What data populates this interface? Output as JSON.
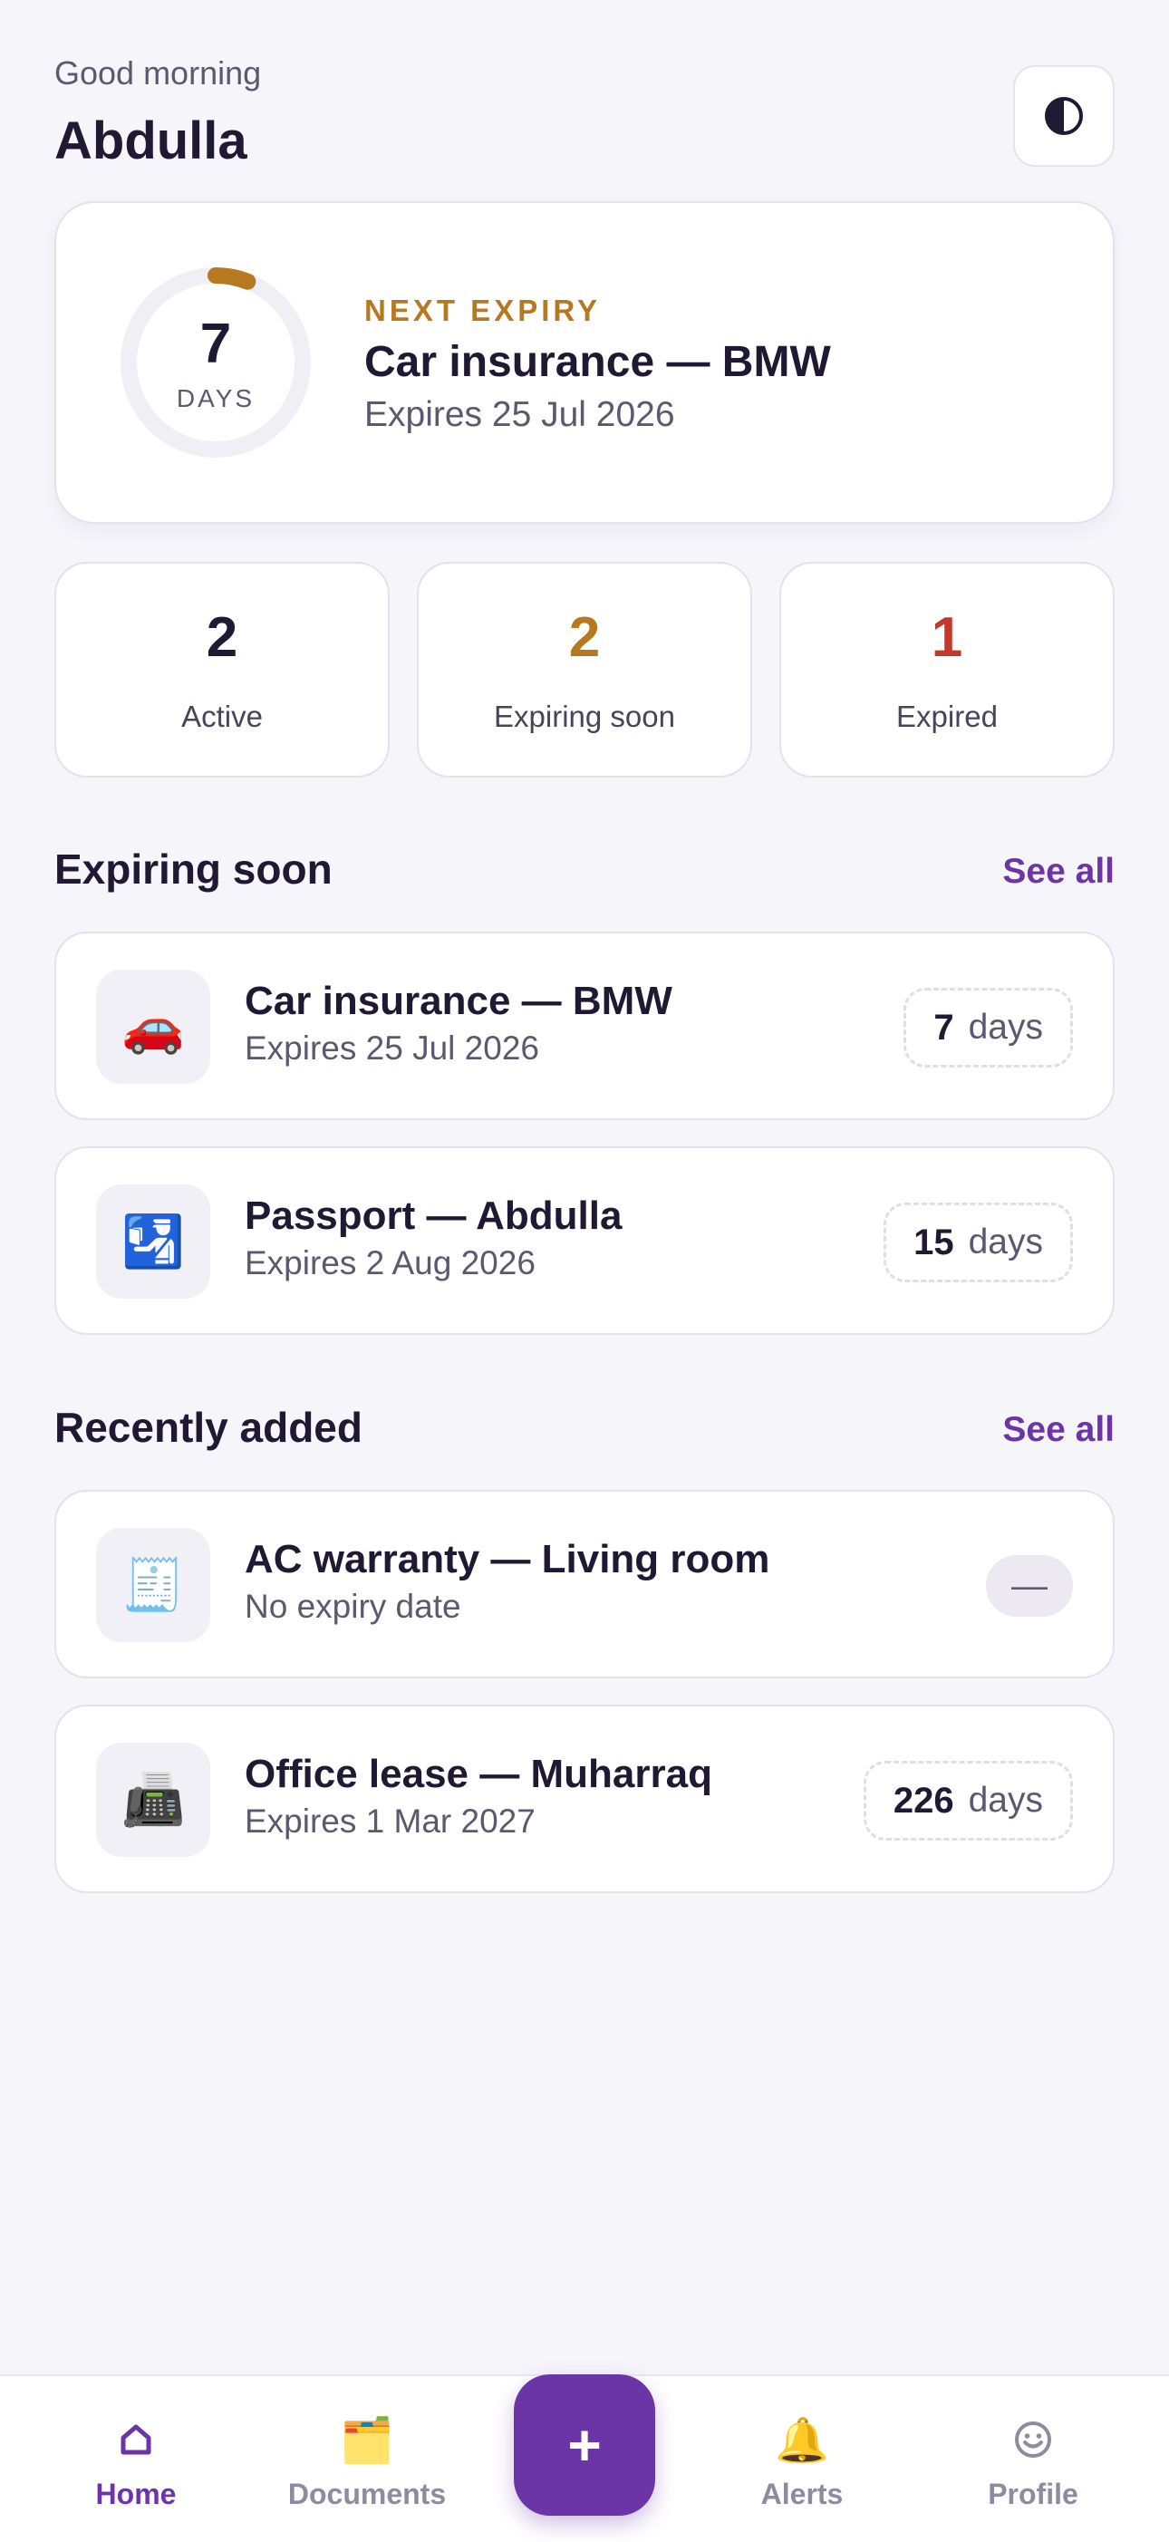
{
  "header": {
    "greeting": "Good morning",
    "name": "Abdulla",
    "theme_toggle_icon": "contrast-icon"
  },
  "next_expiry": {
    "days": "7",
    "days_unit": "DAYS",
    "kicker": "NEXT EXPIRY",
    "title": "Car insurance — BMW",
    "subtitle": "Expires 25 Jul 2026",
    "progress_fraction": 0.06,
    "accent": "#b7791f"
  },
  "stats": [
    {
      "value": "2",
      "label": "Active",
      "color": "#1f1933"
    },
    {
      "value": "2",
      "label": "Expiring soon",
      "color": "#b7791f"
    },
    {
      "value": "1",
      "label": "Expired",
      "color": "#c0392b"
    }
  ],
  "expiring": {
    "title": "Expiring soon",
    "see_all": "See all",
    "items": [
      {
        "icon": "🚗",
        "icon_name": "car-icon",
        "title": "Car insurance — BMW",
        "subtitle": "Expires 25 Jul 2026",
        "days": "7",
        "unit": "days"
      },
      {
        "icon": "🛂",
        "icon_name": "passport-control-icon",
        "title": "Passport — Abdulla",
        "subtitle": "Expires 2 Aug 2026",
        "days": "15",
        "unit": "days"
      }
    ]
  },
  "recent": {
    "title": "Recently added",
    "see_all": "See all",
    "items": [
      {
        "icon": "🧾",
        "icon_name": "receipt-icon",
        "title": "AC warranty — Living room",
        "subtitle": "No expiry date",
        "badge": "—"
      },
      {
        "icon": "📠",
        "icon_name": "fax-document-icon",
        "title": "Office lease — Muharraq",
        "subtitle": "Expires 1 Mar 2027",
        "days": "226",
        "unit": "days"
      }
    ]
  },
  "tabbar": {
    "home": {
      "label": "Home",
      "icon": "⌂"
    },
    "documents": {
      "label": "Documents",
      "icon": "🗂️"
    },
    "add": {
      "label": "+"
    },
    "alerts": {
      "label": "Alerts",
      "icon": "🔔"
    },
    "profile": {
      "label": "Profile",
      "icon": "☺"
    }
  },
  "colors": {
    "brand": "#6b35a8",
    "background": "#f6f5fa",
    "warning": "#b7791f",
    "danger": "#c0392b"
  }
}
